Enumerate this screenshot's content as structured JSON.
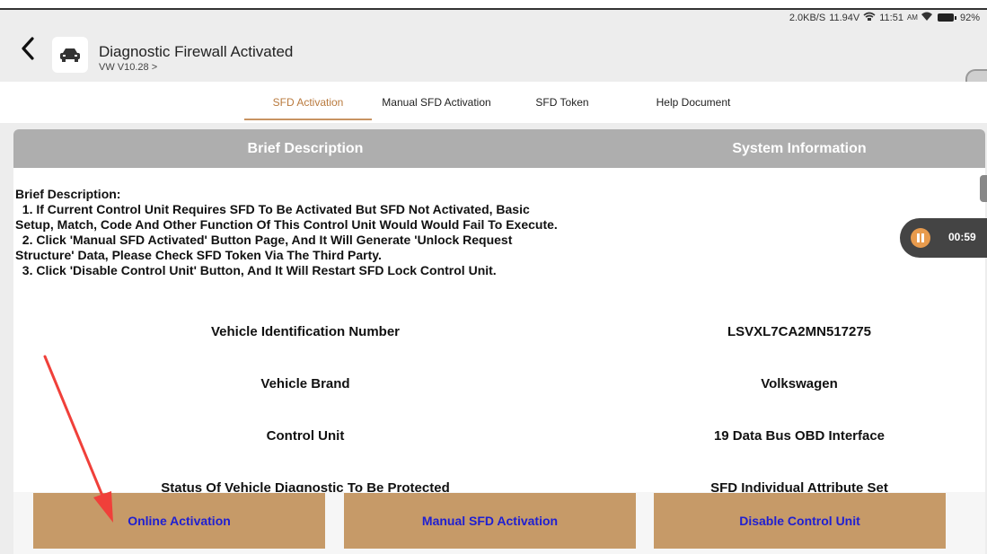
{
  "status_bar": {
    "network_speed": "2.0KB/S",
    "voltage": "11.94V",
    "time": "11:51",
    "am_pm": "AM",
    "battery": "92%"
  },
  "header": {
    "title": "Diagnostic Firewall Activated",
    "subtitle": "VW V10.28 >"
  },
  "tabs": [
    {
      "label": "SFD Activation",
      "active": true
    },
    {
      "label": "Manual SFD Activation",
      "active": false
    },
    {
      "label": "SFD Token",
      "active": false
    },
    {
      "label": "Help Document",
      "active": false
    }
  ],
  "panel": {
    "col_left": "Brief Description",
    "col_right": "System Information",
    "description": [
      "Brief Description:",
      "  1. If Current Control Unit Requires SFD To Be Activated But SFD Not Activated, Basic",
      "Setup, Match, Code And Other Function Of This Control Unit Would Would Fail To Execute.",
      "  2. Click 'Manual SFD Activated' Button Page, And It Will Generate 'Unlock Request",
      "Structure' Data, Please Check SFD Token Via The Third Party.",
      "  3. Click 'Disable Control Unit' Button, And It Will Restart SFD Lock Control Unit."
    ],
    "rows": [
      {
        "label": "Vehicle Identification Number",
        "value": "LSVXL7CA2MN517275"
      },
      {
        "label": "Vehicle Brand",
        "value": "Volkswagen"
      },
      {
        "label": "Control Unit",
        "value": "19 Data Bus OBD Interface"
      },
      {
        "label": "Status Of Vehicle Diagnostic To Be Protected",
        "value": "SFD Individual Attribute Set"
      }
    ]
  },
  "buttons": {
    "online": "Online Activation",
    "manual": "Manual SFD Activation",
    "disable": "Disable Control Unit"
  },
  "timer": {
    "value": "00:59"
  },
  "colors": {
    "accent": "#c89462",
    "button_bg": "#c69a68",
    "button_text": "#1f1fd1",
    "header_bar": "#aeaeae",
    "annotation_arrow": "#f0403a"
  }
}
